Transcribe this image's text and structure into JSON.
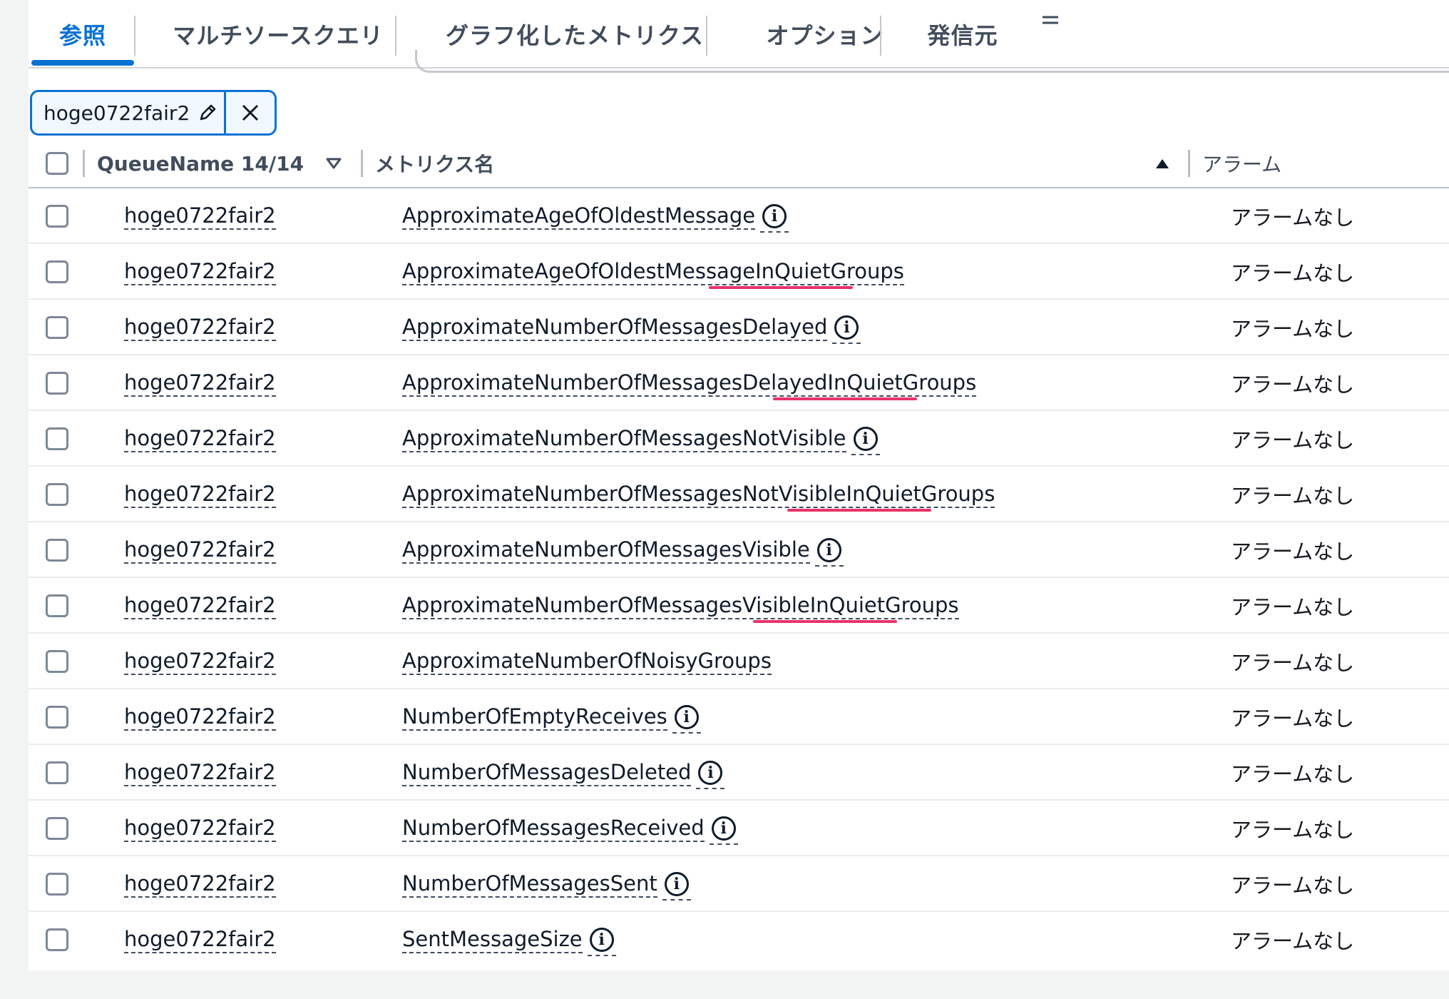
{
  "tabs": [
    {
      "label": "参照",
      "active": true
    },
    {
      "label": "マルチソースクエリ",
      "active": false
    },
    {
      "label": "グラフ化したメトリクス",
      "active": false
    },
    {
      "label": "オプション",
      "active": false
    },
    {
      "label": "発信元",
      "active": false
    }
  ],
  "filter_token": {
    "label": "hoge0722fair2"
  },
  "table": {
    "headers": {
      "queue_name": "QueueName 14/14",
      "metric_name": "メトリクス名",
      "alarm": "アラーム"
    },
    "rows": [
      {
        "queue": "hoge0722fair2",
        "metric": "ApproximateAgeOfOldestMessage",
        "info": true,
        "alarm": "アラームなし"
      },
      {
        "queue": "hoge0722fair2",
        "metric": "ApproximateAgeOfOldestMessageInQuietGroups",
        "info": false,
        "alarm": "アラームなし"
      },
      {
        "queue": "hoge0722fair2",
        "metric": "ApproximateNumberOfMessagesDelayed",
        "info": true,
        "alarm": "アラームなし"
      },
      {
        "queue": "hoge0722fair2",
        "metric": "ApproximateNumberOfMessagesDelayedInQuietGroups",
        "info": false,
        "alarm": "アラームなし"
      },
      {
        "queue": "hoge0722fair2",
        "metric": "ApproximateNumberOfMessagesNotVisible",
        "info": true,
        "alarm": "アラームなし"
      },
      {
        "queue": "hoge0722fair2",
        "metric": "ApproximateNumberOfMessagesNotVisibleInQuietGroups",
        "info": false,
        "alarm": "アラームなし"
      },
      {
        "queue": "hoge0722fair2",
        "metric": "ApproximateNumberOfMessagesVisible",
        "info": true,
        "alarm": "アラームなし"
      },
      {
        "queue": "hoge0722fair2",
        "metric": "ApproximateNumberOfMessagesVisibleInQuietGroups",
        "info": false,
        "alarm": "アラームなし"
      },
      {
        "queue": "hoge0722fair2",
        "metric": "ApproximateNumberOfNoisyGroups",
        "info": false,
        "alarm": "アラームなし"
      },
      {
        "queue": "hoge0722fair2",
        "metric": "NumberOfEmptyReceives",
        "info": true,
        "alarm": "アラームなし"
      },
      {
        "queue": "hoge0722fair2",
        "metric": "NumberOfMessagesDeleted",
        "info": true,
        "alarm": "アラームなし"
      },
      {
        "queue": "hoge0722fair2",
        "metric": "NumberOfMessagesReceived",
        "info": true,
        "alarm": "アラームなし"
      },
      {
        "queue": "hoge0722fair2",
        "metric": "NumberOfMessagesSent",
        "info": true,
        "alarm": "アラームなし"
      },
      {
        "queue": "hoge0722fair2",
        "metric": "SentMessageSize",
        "info": true,
        "alarm": "アラームなし"
      }
    ]
  },
  "info_icon_glyph": "i",
  "colors": {
    "accent": "#0972d3",
    "highlight": "#e8336d"
  }
}
